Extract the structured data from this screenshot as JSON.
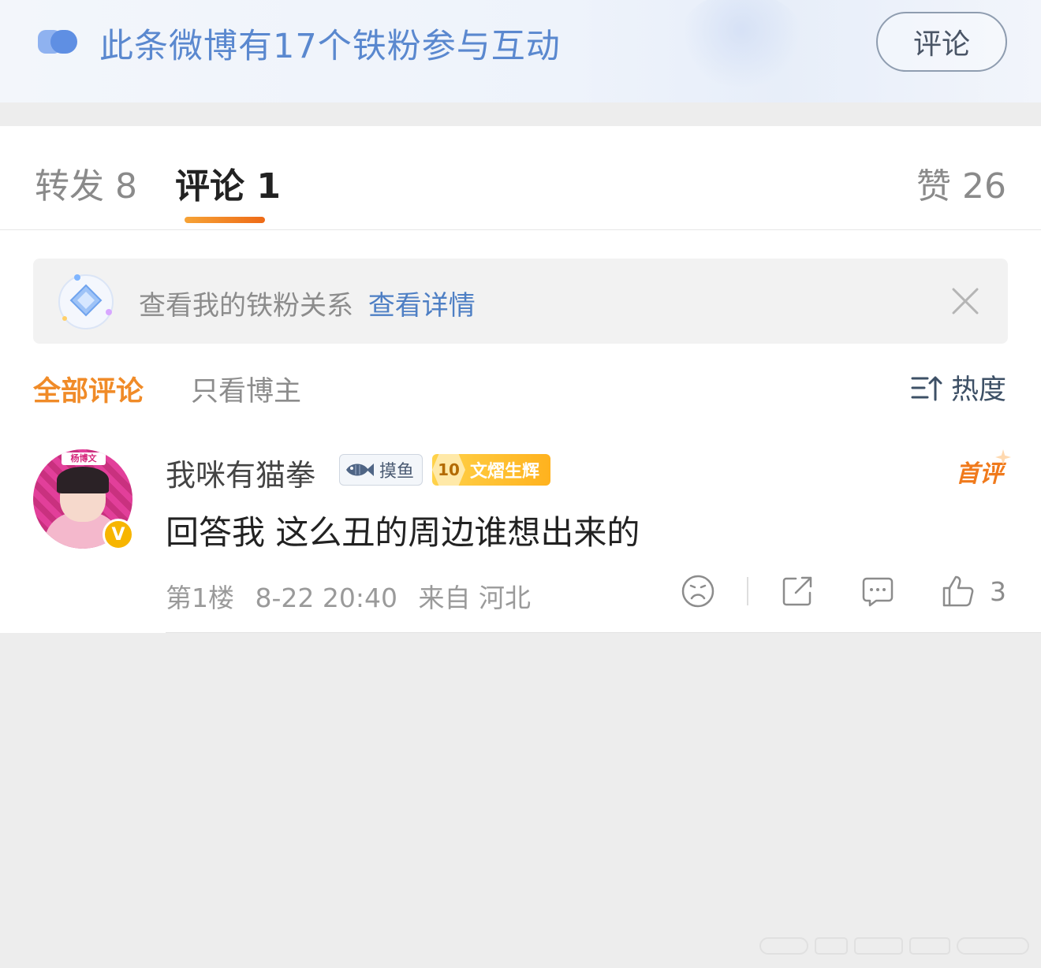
{
  "banner": {
    "fans_text": "此条微博有17个铁粉参与互动",
    "comment_button": "评论"
  },
  "tabs": {
    "forward": "转发 8",
    "comment": "评论 1",
    "like": "赞 26"
  },
  "fan_relation": {
    "text": "查看我的铁粉关系",
    "link": "查看详情"
  },
  "filters": {
    "all": "全部评论",
    "author_only": "只看博主",
    "sort": "热度"
  },
  "comment": {
    "avatar_tag": "杨博文",
    "username": "我咪有猫拳",
    "badge_moyu": "摸鱼",
    "badge_level": "10",
    "badge_wenxi": "文熠生辉",
    "first_label": "首评",
    "text": "回答我 这么丑的周边谁想出来的",
    "floor": "第1楼",
    "time": "8-22 20:40",
    "source": "来自 河北",
    "likes": "3"
  },
  "icons": [
    "fans-icon",
    "diamond-icon",
    "close-icon",
    "sort-icon",
    "fish-icon",
    "frown-icon",
    "share-icon",
    "reply-icon",
    "thumbs-up-icon",
    "verified-icon"
  ],
  "colors": {
    "accent_orange": "#f08b28",
    "link_blue": "#4e7fc4",
    "banner_blue": "#5a88cf",
    "verified_gold": "#f7b500"
  }
}
